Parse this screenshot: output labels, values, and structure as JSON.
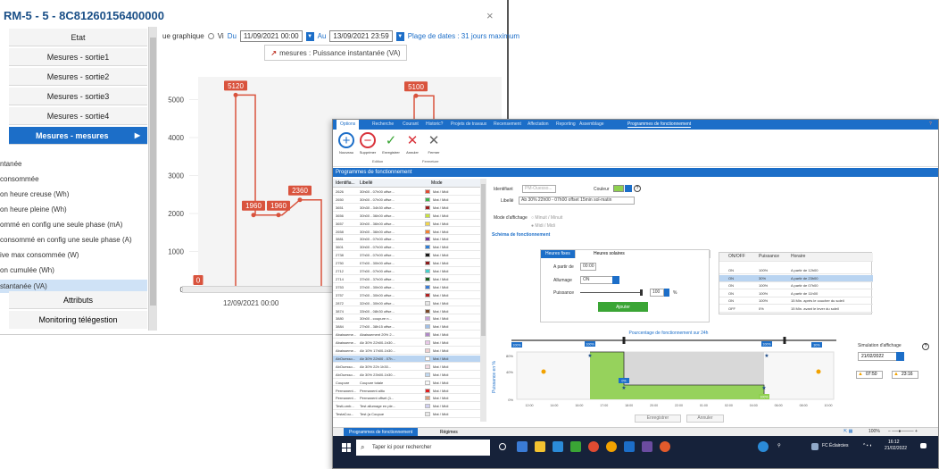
{
  "back_window": {
    "title": "RM-5 - 5 - 8C81260156400000",
    "close": "×",
    "menu": {
      "etat": "Etat",
      "sorties": [
        "Mesures - sortie1",
        "Mesures - sortie2",
        "Mesures - sortie3",
        "Mesures - sortie4"
      ],
      "active": "Mesures - mesures",
      "active_arrow": "▶",
      "measures": [
        "ntanée",
        "consommée",
        "on heure creuse (Wh)",
        "on heure pleine (Wh)",
        "ommé en config une seule phase (mA)",
        "consommé en config une seule phase (A)",
        "ive max consommée (W)",
        "on cumulée (Wh)",
        "stantanée (VA)"
      ],
      "selected_measure_index": 8,
      "attributs": "Attributs",
      "monitoring": "Monitoring télégestion"
    },
    "toolbar": {
      "graph_label": "ue graphique",
      "radio_label": "Vi",
      "du_label": "Du",
      "du_value": "11/09/2021 00:00",
      "au_label": "Au",
      "au_value": "13/09/2021 23:59",
      "range_note": "Plage de dates : 31 jours maximum"
    },
    "legend": "mesures : Puissance instantanée (VA)",
    "chart_data": {
      "type": "line",
      "y_ticks": [
        0,
        1000,
        2000,
        3000,
        4000,
        5000
      ],
      "ylim": [
        0,
        5600
      ],
      "x_tick_label": "12/09/2021 00:00",
      "series": [
        {
          "color": "#d9533d",
          "labels": [
            {
              "text": "5120",
              "value": 5120
            },
            {
              "text": "1960",
              "value": 1960
            },
            {
              "text": "1960",
              "value": 1960
            },
            {
              "text": "2360",
              "value": 2360
            },
            {
              "text": "5100",
              "value": 5100
            },
            {
              "text": "0",
              "value": 0
            },
            {
              "text": "0",
              "value": 0
            }
          ]
        }
      ]
    }
  },
  "front_window": {
    "ribbon_tabs": [
      "Options",
      "Recherche",
      "Courant",
      "Historic?",
      "Projets de travaux",
      "Recensement",
      "Affectation",
      "Reporting",
      "Assemblage"
    ],
    "ribbon_active_tab": "Programmes de fonctionnement",
    "ribbon_buttons": [
      {
        "label": "Nouveau",
        "icon": "plus-circle-icon",
        "glyph": "+",
        "color": "#1c6ec8"
      },
      {
        "label": "Supprimer",
        "icon": "minus-circle-icon",
        "glyph": "−",
        "color": "#d9323a"
      },
      {
        "label": "Enregistrer",
        "icon": "check-icon",
        "glyph": "✓",
        "color": "#3aa535"
      },
      {
        "label": "Annuler",
        "icon": "cross-icon",
        "glyph": "✕",
        "color": "#d9323a"
      },
      {
        "label": "Fermer",
        "icon": "close-icon",
        "glyph": "✕",
        "color": "#666666"
      }
    ],
    "ribbon_groups": [
      "Edition",
      "Fermeture"
    ],
    "section_title": "Programmes de fonctionnement",
    "grid": {
      "columns": [
        "Identifia...",
        "Libellé",
        "Mode"
      ],
      "rows": [
        [
          "2626",
          "30h00 - 07h00 offse...",
          "Mat / Midi",
          "#e04b32"
        ],
        [
          "2650",
          "30h00 - 07h00 offse...",
          "Mat / Midi",
          "#3cb44b"
        ],
        [
          "3651",
          "30h30 - 34h30 offse...",
          "Mat / Midi",
          "#9b1c1c"
        ],
        [
          "3656",
          "30h00 - 36h00 offse...",
          "Mat / Midi",
          "#c8e23c"
        ],
        [
          "3657",
          "30h00 - 36h00 offse...",
          "Mat / Midi",
          "#f2d64b"
        ],
        [
          "2658",
          "30h00 - 36h00 offse...",
          "Mat / Midi",
          "#f58231"
        ],
        [
          "3881",
          "30h00 - 07h00 offse...",
          "Mat / Midi",
          "#7b2f9b"
        ],
        [
          "3601",
          "30h00 - 07h00 offse...",
          "Mat / Midi",
          "#2e7dd6"
        ],
        [
          "2738",
          "37h00 - 07h00 offse...",
          "Mat / Midi",
          "#1a1a1a"
        ],
        [
          "2750",
          "07h00 - 30h00 offse...",
          "Mat / Midi",
          "#8b1a1a"
        ],
        [
          "2712",
          "37h00 - 07h00 offse...",
          "Mat / Midi",
          "#48d1cc"
        ],
        [
          "2714",
          "37h00 - 37h00 offse...",
          "Mat / Midi",
          "#1a5c1a"
        ],
        [
          "3753",
          "37h00 - 30h00 offse...",
          "Mat / Midi",
          "#3a7bd5"
        ],
        [
          "3757",
          "37h00 - 30h00 offse...",
          "Mat / Midi",
          "#b22222"
        ],
        [
          "2872",
          "32h00 - 30h00 offse...",
          "Mat / Midi",
          "#e8e8e8"
        ],
        [
          "3874",
          "33h00 - 08h30 offse...",
          "Mat / Midi",
          "#7a4a2a"
        ],
        [
          "3880",
          "30h00 - coupure n...",
          "Mat / Midi",
          "#c8a0d8"
        ],
        [
          "3884",
          "27h00 - 38h15 offse...",
          "Mat / Midi",
          "#a0c0e8"
        ],
        [
          "Abaisseme...",
          "Abaissement 20% 2...",
          "Mat / Midi",
          "#b088c8"
        ],
        [
          "Abaisseme...",
          "Ab 30% 22h00-1h30...",
          "Mat / Midi",
          "#e8c8e8"
        ],
        [
          "Abaisseme...",
          "Ab 10% 17h00-1h30...",
          "Mat / Midi",
          "#f0d0d0"
        ],
        [
          "AbOuesso...",
          "Ab 30% 22h00 - 07h...",
          "Mat / Midi",
          "#ffffff"
        ],
        [
          "AbOuesso...",
          "Ab 30% 22h 1h30...",
          "Mat / Midi",
          "#f0d8e0"
        ],
        [
          "AbOuesso...",
          "Ab 30% 23h00-1h30...",
          "Mat / Midi",
          "#c0d8f0"
        ],
        [
          "Coupure",
          "Coupure totale",
          "Mat / Midi",
          "#f8f8f8"
        ],
        [
          "Permanent...",
          "Permanent allto",
          "Mat / Midi",
          "#e02020"
        ],
        [
          "Permanent...",
          "Permanent offset (1...",
          "Mat / Midi",
          "#d8a080"
        ],
        [
          "TestLumb...",
          "Test allumage en ple...",
          "Mat / Midi",
          "#d0d0f0"
        ],
        [
          "TestaCou...",
          "Test (a Coupue",
          "Mat / Midi",
          "#e8e8e8"
        ]
      ],
      "selected_row_index": 21
    },
    "form": {
      "identifiant_label": "Identifiant",
      "identifiant_placeholder": "PM-Ouesso...",
      "couleur_label": "Couleur",
      "couleur_value": "#8fd14f",
      "libelle_label": "Libellé",
      "libelle_value": "Ab 30% 22h00 - 07h00 offset 15min sol-matin",
      "mode_label": "Mode d'affichage",
      "mode_options": [
        "Minuit / Minuit",
        "Midi / Midi"
      ],
      "mode_selected_index": 1,
      "schema_title": "Schéma de fonctionnement"
    },
    "heures": {
      "tabs": [
        "Heures fixes",
        "Heures solaires"
      ],
      "active_tab_index": 0,
      "apartir_label": "A partir de",
      "apartir_value": "00:00",
      "allumage_label": "Allumage",
      "allumage_value": "ON",
      "puissance_label": "Puissance",
      "puissance_value": "100",
      "puissance_level": 1.0,
      "percent": "%",
      "ajouter": "Ajouter"
    },
    "right_table": {
      "columns": [
        "ON/OFF",
        "Puissance",
        "Horaire"
      ],
      "rows": [
        [
          "ON",
          "100%",
          "A partir de 12h00"
        ],
        [
          "ON",
          "30%",
          "A partir de 23h00"
        ],
        [
          "ON",
          "100%",
          "A partir de 07h00"
        ],
        [
          "ON",
          "100%",
          "A partir de 11h00"
        ],
        [
          "ON",
          "100%",
          "15 Min. après le coucher du soleil"
        ],
        [
          "OFF",
          "0%",
          "15 Min. avant le lever du soleil"
        ]
      ],
      "selected_row_index": 1
    },
    "sched_chart": {
      "type": "area",
      "title": "Pourcentage de fonctionnement sur 24h",
      "ylabel": "Puissance en %",
      "y_ticks": [
        "0%",
        "40%",
        "80%"
      ],
      "x_ticks": [
        "12:00",
        "14:00",
        "16:00",
        "17:00",
        "18:00",
        "20:00",
        "22:00",
        "01:00",
        "02:00",
        "04:00",
        "06:00",
        "08:00",
        "10:00"
      ],
      "badges": [
        "100%",
        "100%",
        "100%",
        "30%",
        "0%",
        "100%"
      ],
      "active_color": "#8fd14f"
    },
    "simulation": {
      "label": "Simulation d'affichage",
      "help": "?",
      "date": "21/02/2022",
      "time_start": "07:50",
      "time_end": "23:16"
    },
    "buttons": {
      "enregistrer": "Enregistrer",
      "annuler": "Annuler"
    },
    "bottom_tabs": [
      "Programmes de fonctionnement",
      "Régimes"
    ],
    "zoom": "100%",
    "taskbar": {
      "search_placeholder": "Taper ici pour rechercher",
      "status": "FC Éclaircies",
      "clock_time": "16:12",
      "clock_date": "21/02/2022"
    }
  }
}
